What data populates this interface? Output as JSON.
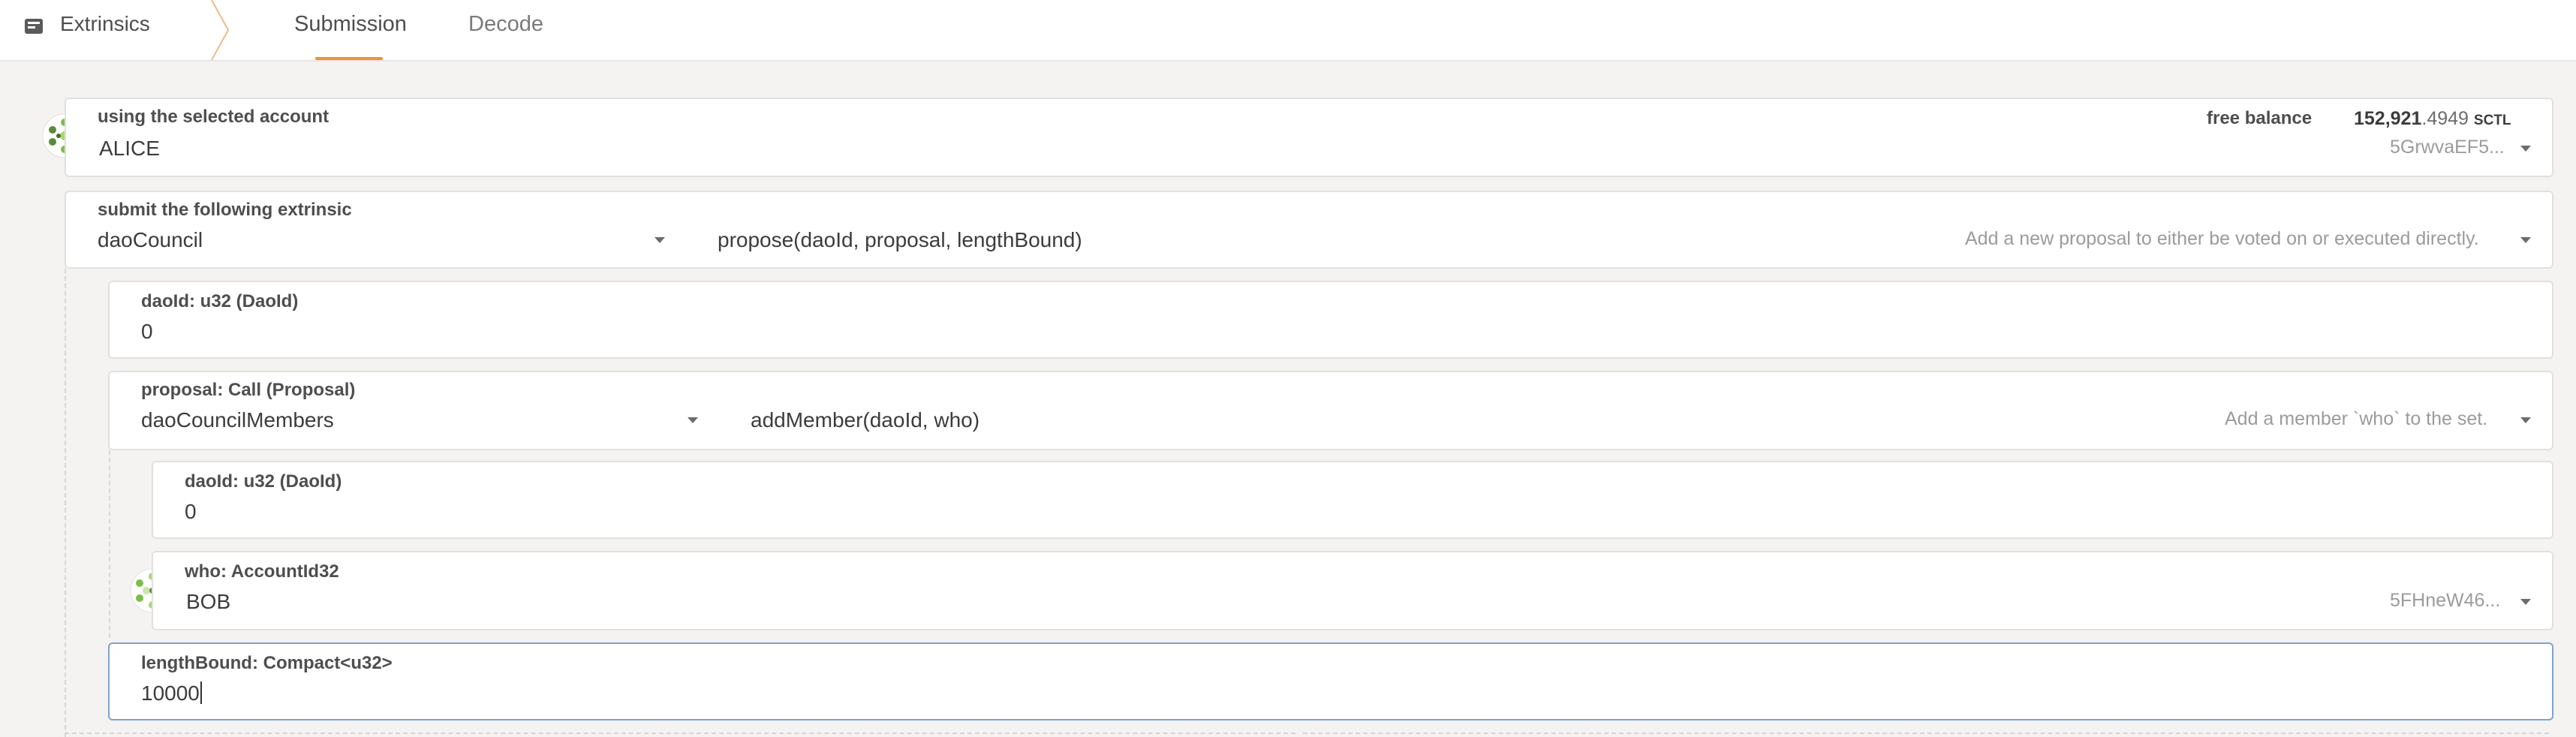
{
  "header": {
    "section_label": "Extrinsics",
    "tabs": [
      {
        "label": "Submission",
        "active": true
      },
      {
        "label": "Decode",
        "active": false
      }
    ],
    "accent_color": "#f19135"
  },
  "account": {
    "label": "using the selected account",
    "name": "ALICE",
    "balance_label": "free balance",
    "balance_main": "152,921",
    "balance_decimals": ".4949",
    "balance_unit": "SCTL",
    "address": "5GrwvaEF5..."
  },
  "extrinsic": {
    "label": "submit the following extrinsic",
    "module": "daoCouncil",
    "method": "propose(daoId, proposal, lengthBound)",
    "description": "Add a new proposal to either be voted on or executed directly."
  },
  "params": {
    "dao_id": {
      "label": "daoId: u32 (DaoId)",
      "value": "0"
    },
    "proposal": {
      "label": "proposal: Call (Proposal)",
      "module": "daoCouncilMembers",
      "method": "addMember(daoId, who)",
      "description": "Add a member `who` to the set."
    },
    "inner_dao_id": {
      "label": "daoId: u32 (DaoId)",
      "value": "0"
    },
    "who": {
      "label": "who: AccountId32",
      "name": "BOB",
      "address": "5FHneW46..."
    },
    "length_bound": {
      "label": "lengthBound: Compact<u32>",
      "value": "10000"
    }
  },
  "icons": {
    "section": "extrinsics-icon",
    "alice_avatar": "identicon",
    "bob_avatar": "identicon"
  }
}
